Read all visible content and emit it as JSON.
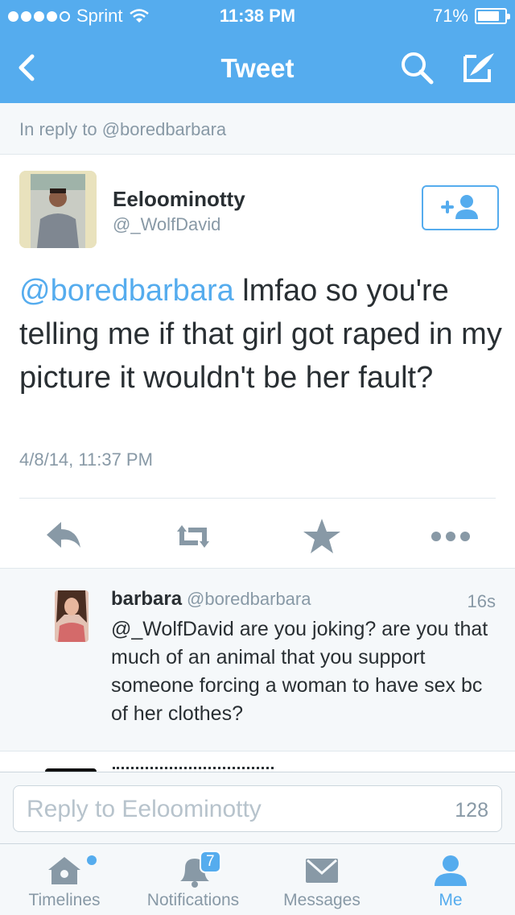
{
  "status_bar": {
    "carrier": "Sprint",
    "time": "11:38 PM",
    "battery": "71%",
    "battery_level": 0.71
  },
  "nav": {
    "title": "Tweet"
  },
  "in_reply_to": "In reply to @boredbarbara",
  "tweet": {
    "author_name": "Eeloominotty",
    "author_handle": "@_WolfDavid",
    "mention": "@boredbarbara",
    "text": " lmfao so you're telling me if that girl got raped in my picture it wouldn't be her fault?",
    "timestamp": "4/8/14, 11:37 PM"
  },
  "reply": {
    "name": "barbara",
    "handle": "@boredbarbara",
    "time": "16s",
    "text": "@_WolfDavid are you joking? are you that much of an animal that you support someone forcing a woman to have sex bc of her clothes?"
  },
  "composer": {
    "placeholder": "Reply to Eeloominotty",
    "char_count": "128"
  },
  "tabs": [
    {
      "label": "Timelines"
    },
    {
      "label": "Notifications",
      "badge": "7"
    },
    {
      "label": "Messages"
    },
    {
      "label": "Me"
    }
  ],
  "colors": {
    "accent": "#55acee",
    "secondary_text": "#8899a6",
    "text": "#292f33"
  }
}
